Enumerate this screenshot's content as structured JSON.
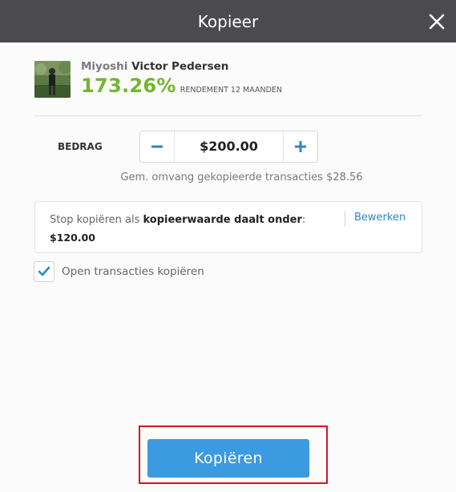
{
  "dialog": {
    "title": "Kopieer",
    "close_icon": "close-icon"
  },
  "trader": {
    "first_name": "Miyoshi",
    "last_name": "Victor Pedersen",
    "gain": "173.26%",
    "gain_label": "RENDEMENT 12 MAANDEN",
    "gain_color": "#72b62c"
  },
  "amount": {
    "label": "BEDRAG",
    "value": "$200.00",
    "minus_icon": "minus-icon",
    "plus_icon": "plus-icon"
  },
  "avg_copied": "Gem. omvang gekopieerde transacties $28.56",
  "stop_loss": {
    "prefix": "Stop kopiëren als ",
    "bold": "kopieerwaarde daalt onder",
    "suffix": ":",
    "value": "$120.00",
    "edit_label": "Bewerken"
  },
  "open_trades": {
    "checked": true,
    "label": "Open transacties kopiëren"
  },
  "copy_button": {
    "label": "Kopiëren",
    "color": "#3b9ae0"
  },
  "colors": {
    "header_bg": "#4a4a4f",
    "accent_blue": "#2e86c8",
    "highlight": "#d8161b"
  }
}
